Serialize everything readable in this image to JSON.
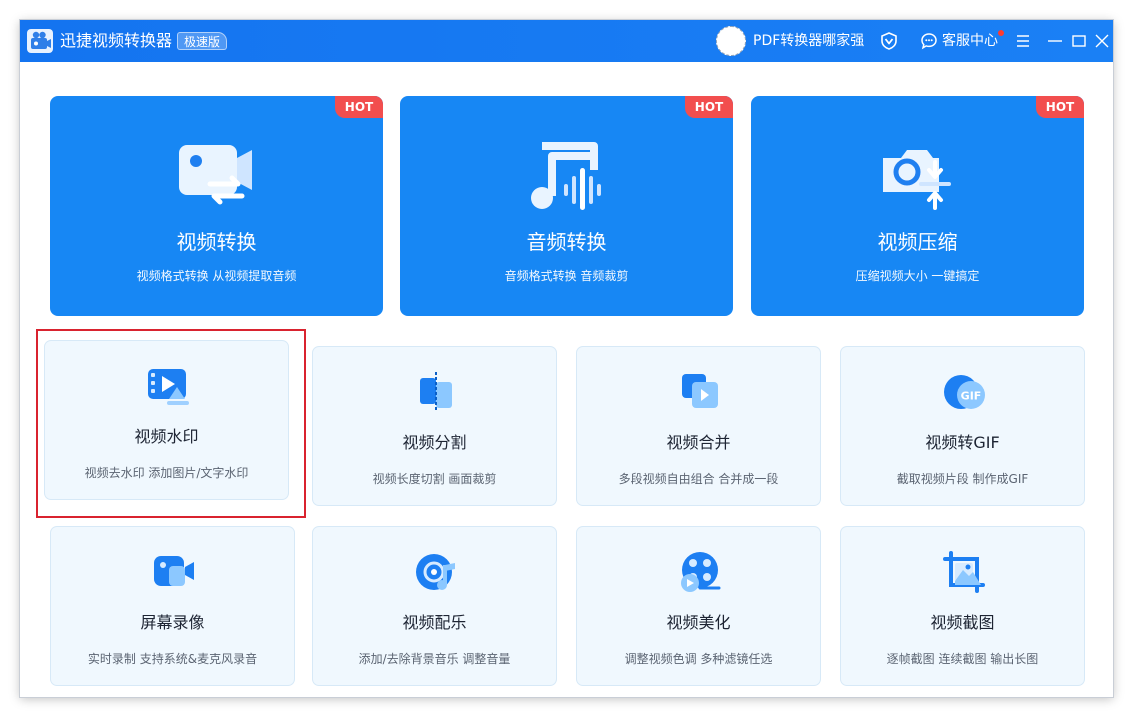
{
  "app": {
    "title": "迅捷视频转换器",
    "edition": "极速版"
  },
  "header": {
    "user_name": "PDF转换器哪家强",
    "support_label": "客服中心"
  },
  "colors": {
    "title_bar": "#1474f0",
    "hot_card": "#1787f4",
    "hot_badge": "#f24e4e",
    "tool_card": "#f0f8fe",
    "highlight": "#d9232f"
  },
  "hot_features": [
    {
      "title": "视频转换",
      "desc": "视频格式转换 从视频提取音频",
      "badge": "HOT",
      "icon": "video-convert-icon"
    },
    {
      "title": "音频转换",
      "desc": "音频格式转换 音频裁剪",
      "badge": "HOT",
      "icon": "audio-convert-icon"
    },
    {
      "title": "视频压缩",
      "desc": "压缩视频大小 一键搞定",
      "badge": "HOT",
      "icon": "video-compress-icon"
    }
  ],
  "tools": [
    {
      "title": "视频水印",
      "desc": "视频去水印 添加图片/文字水印",
      "icon": "watermark-icon"
    },
    {
      "title": "视频分割",
      "desc": "视频长度切割 画面裁剪",
      "icon": "split-icon"
    },
    {
      "title": "视频合并",
      "desc": "多段视频自由组合 合并成一段",
      "icon": "merge-icon"
    },
    {
      "title": "视频转GIF",
      "desc": "截取视频片段 制作成GIF",
      "icon": "gif-icon"
    },
    {
      "title": "屏幕录像",
      "desc": "实时录制 支持系统&麦克风录音",
      "icon": "screen-record-icon"
    },
    {
      "title": "视频配乐",
      "desc": "添加/去除背景音乐 调整音量",
      "icon": "music-icon"
    },
    {
      "title": "视频美化",
      "desc": "调整视频色调 多种滤镜任选",
      "icon": "beautify-icon"
    },
    {
      "title": "视频截图",
      "desc": "逐帧截图 连续截图 输出长图",
      "icon": "screenshot-icon"
    }
  ],
  "gif_icon_text": "GIF"
}
